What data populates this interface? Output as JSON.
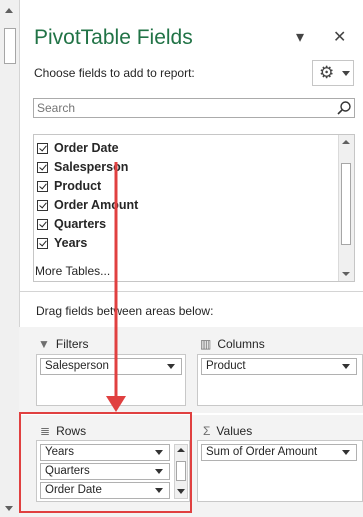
{
  "header": {
    "title": "PivotTable Fields",
    "choose_label": "Choose fields to add to report:"
  },
  "search": {
    "placeholder": "Search",
    "value": "Search"
  },
  "fields": [
    {
      "label": "Order Date",
      "checked": true
    },
    {
      "label": "Salesperson",
      "checked": true
    },
    {
      "label": "Product",
      "checked": true
    },
    {
      "label": "Order Amount",
      "checked": true
    },
    {
      "label": "Quarters",
      "checked": true
    },
    {
      "label": "Years",
      "checked": true
    }
  ],
  "more_tables": "More Tables...",
  "drag_label": "Drag fields between areas below:",
  "areas": {
    "filters": {
      "label": "Filters",
      "items": [
        "Salesperson"
      ]
    },
    "columns": {
      "label": "Columns",
      "items": [
        "Product"
      ]
    },
    "rows": {
      "label": "Rows",
      "items": [
        "Years",
        "Quarters",
        "Order Date"
      ]
    },
    "values": {
      "label": "Values",
      "items": [
        "Sum of Order Amount"
      ]
    }
  },
  "icons": {
    "close": "close-icon",
    "gear": "gear-icon",
    "search": "search-icon",
    "filter": "filter-icon",
    "columns": "columns-icon",
    "rows": "rows-icon",
    "sigma": "sigma-icon"
  },
  "colors": {
    "title": "#217346",
    "highlight": "#e04040",
    "band": "#f3f3f3"
  }
}
